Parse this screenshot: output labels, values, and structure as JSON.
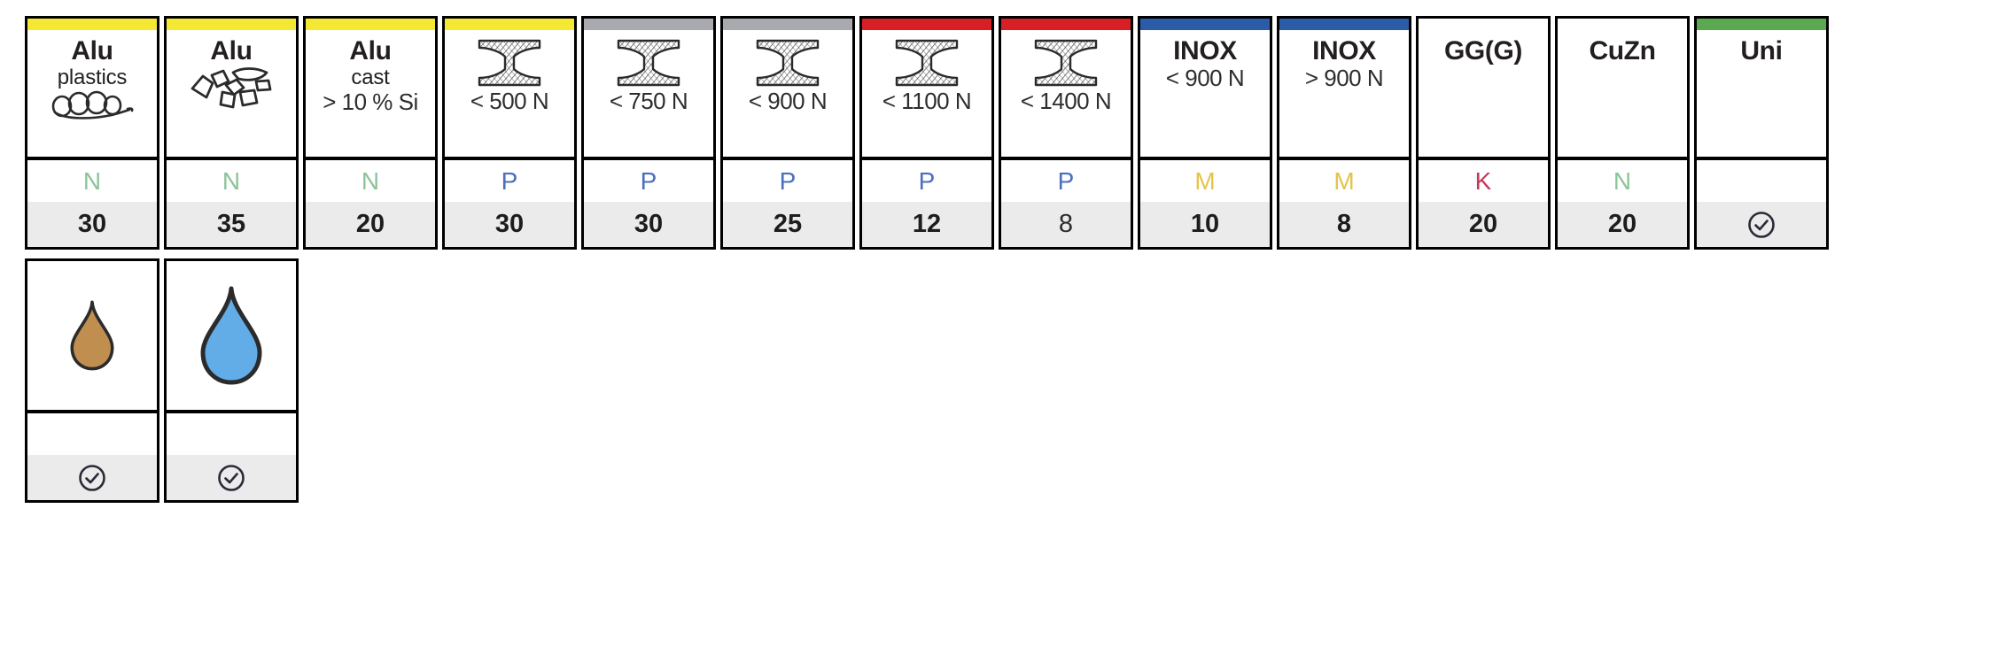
{
  "legend": {
    "letter_colors": {
      "N": "#8bc49a",
      "P": "#4a6fbe",
      "M": "#e6c34a",
      "K": "#c43a57"
    },
    "bar_colors": {
      "yellow": "#f5e832",
      "gray": "#a9aaae",
      "red": "#d81f26",
      "blue": "#2a5ca8",
      "green": "#5aa84f",
      "none": "#ffffff"
    },
    "drop_colors": {
      "oil": "#c08e4f",
      "emulsion": "#62ace8"
    },
    "check_color": "#2b2b38"
  },
  "row1": [
    {
      "bar": "yellow",
      "title": "Alu",
      "sub": "plastics",
      "cond": "",
      "icon": "chip-spiral-icon",
      "letter": "N",
      "letter_color": "#8bc49a",
      "value": "30",
      "value_style": "bold"
    },
    {
      "bar": "yellow",
      "title": "Alu",
      "sub": "",
      "cond": "",
      "icon": "chip-fragments-icon",
      "letter": "N",
      "letter_color": "#8bc49a",
      "value": "35",
      "value_style": "bold"
    },
    {
      "bar": "yellow",
      "title": "Alu",
      "sub": "cast",
      "cond": "> 10 % Si",
      "icon": "",
      "letter": "N",
      "letter_color": "#8bc49a",
      "value": "20",
      "value_style": "bold"
    },
    {
      "bar": "yellow",
      "title": "",
      "sub": "",
      "cond": "< 500 N",
      "icon": "i-beam-icon",
      "letter": "P",
      "letter_color": "#4a6fbe",
      "value": "30",
      "value_style": "bold"
    },
    {
      "bar": "gray",
      "title": "",
      "sub": "",
      "cond": "< 750 N",
      "icon": "i-beam-icon",
      "letter": "P",
      "letter_color": "#4a6fbe",
      "value": "30",
      "value_style": "bold"
    },
    {
      "bar": "gray",
      "title": "",
      "sub": "",
      "cond": "< 900 N",
      "icon": "i-beam-icon",
      "letter": "P",
      "letter_color": "#4a6fbe",
      "value": "25",
      "value_style": "bold"
    },
    {
      "bar": "red",
      "title": "",
      "sub": "",
      "cond": "< 1100 N",
      "icon": "i-beam-icon",
      "letter": "P",
      "letter_color": "#4a6fbe",
      "value": "12",
      "value_style": "bold"
    },
    {
      "bar": "red",
      "title": "",
      "sub": "",
      "cond": "< 1400 N",
      "icon": "i-beam-icon",
      "letter": "P",
      "letter_color": "#4a6fbe",
      "value": "8",
      "value_style": "light"
    },
    {
      "bar": "blue",
      "title": "INOX",
      "sub": "",
      "cond": "< 900 N",
      "icon": "",
      "letter": "M",
      "letter_color": "#e6c34a",
      "value": "10",
      "value_style": "bold"
    },
    {
      "bar": "blue",
      "title": "INOX",
      "sub": "",
      "cond": "> 900 N",
      "icon": "",
      "letter": "M",
      "letter_color": "#e6c34a",
      "value": "8",
      "value_style": "bold"
    },
    {
      "bar": "none",
      "title": "GG(G)",
      "sub": "",
      "cond": "",
      "icon": "",
      "letter": "K",
      "letter_color": "#c43a57",
      "value": "20",
      "value_style": "bold"
    },
    {
      "bar": "none",
      "title": "CuZn",
      "sub": "",
      "cond": "",
      "icon": "",
      "letter": "N",
      "letter_color": "#8bc49a",
      "value": "20",
      "value_style": "bold"
    },
    {
      "bar": "green",
      "title": "Uni",
      "sub": "",
      "cond": "",
      "icon": "",
      "letter": "",
      "letter_color": "#ffffff",
      "value": "",
      "value_style": "check"
    }
  ],
  "row2": [
    {
      "icon": "oil-droplet-icon",
      "drop_color": "#c08e4f",
      "drop_size": "small",
      "letter": "",
      "value": "",
      "value_style": "check"
    },
    {
      "icon": "emulsion-droplet-icon",
      "drop_color": "#62ace8",
      "drop_size": "large",
      "letter": "",
      "value": "",
      "value_style": "check"
    }
  ]
}
